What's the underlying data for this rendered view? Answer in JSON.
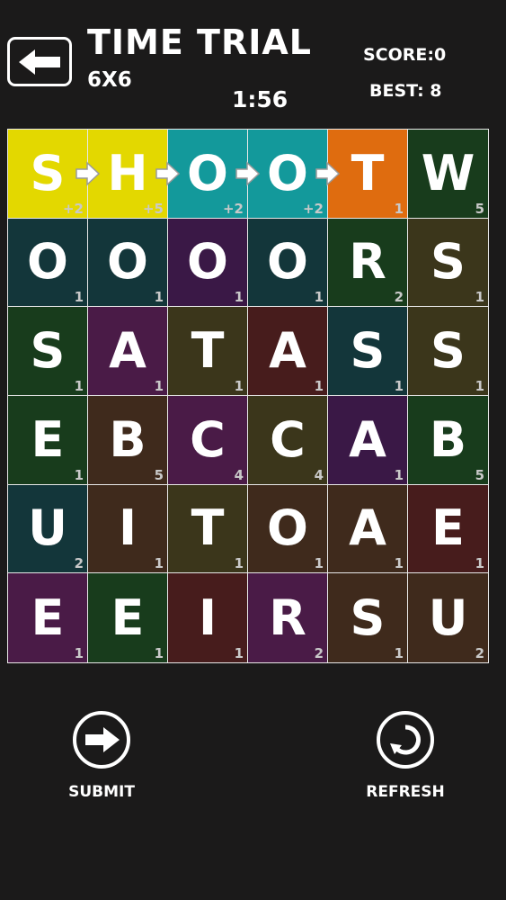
{
  "header": {
    "title": "TIME TRIAL",
    "mode": "6X6",
    "timer": "1:56",
    "score": "SCORE:0",
    "best": "BEST: 8"
  },
  "board": {
    "rows": [
      [
        {
          "letter": "S",
          "points": "+2",
          "color": "#e3d800",
          "arrow": true
        },
        {
          "letter": "H",
          "points": "+5",
          "color": "#e3d800",
          "arrow": true
        },
        {
          "letter": "O",
          "points": "+2",
          "color": "#13999b",
          "arrow": true
        },
        {
          "letter": "O",
          "points": "+2",
          "color": "#13999b",
          "arrow": true
        },
        {
          "letter": "T",
          "points": "1",
          "color": "#df6c0f",
          "arrow": false
        },
        {
          "letter": "W",
          "points": "5",
          "color": "#183c1c",
          "arrow": false
        }
      ],
      [
        {
          "letter": "O",
          "points": "1",
          "color": "#13363a",
          "arrow": false
        },
        {
          "letter": "O",
          "points": "1",
          "color": "#13363a",
          "arrow": false
        },
        {
          "letter": "O",
          "points": "1",
          "color": "#3a1846",
          "arrow": false
        },
        {
          "letter": "O",
          "points": "1",
          "color": "#13363a",
          "arrow": false
        },
        {
          "letter": "R",
          "points": "2",
          "color": "#183c1c",
          "arrow": false
        },
        {
          "letter": "S",
          "points": "1",
          "color": "#3b361b",
          "arrow": false
        }
      ],
      [
        {
          "letter": "S",
          "points": "1",
          "color": "#183c1c",
          "arrow": false
        },
        {
          "letter": "A",
          "points": "1",
          "color": "#4a1b47",
          "arrow": false
        },
        {
          "letter": "T",
          "points": "1",
          "color": "#3b361b",
          "arrow": false
        },
        {
          "letter": "A",
          "points": "1",
          "color": "#471c1c",
          "arrow": false
        },
        {
          "letter": "S",
          "points": "1",
          "color": "#13363a",
          "arrow": false
        },
        {
          "letter": "S",
          "points": "1",
          "color": "#3b361b",
          "arrow": false
        }
      ],
      [
        {
          "letter": "E",
          "points": "1",
          "color": "#183c1c",
          "arrow": false
        },
        {
          "letter": "B",
          "points": "5",
          "color": "#3f2a1c",
          "arrow": false
        },
        {
          "letter": "C",
          "points": "4",
          "color": "#4a1b47",
          "arrow": false
        },
        {
          "letter": "C",
          "points": "4",
          "color": "#3b361b",
          "arrow": false
        },
        {
          "letter": "A",
          "points": "1",
          "color": "#3a1846",
          "arrow": false
        },
        {
          "letter": "B",
          "points": "5",
          "color": "#183c1c",
          "arrow": false
        }
      ],
      [
        {
          "letter": "U",
          "points": "2",
          "color": "#13363a",
          "arrow": false
        },
        {
          "letter": "I",
          "points": "1",
          "color": "#3f2a1c",
          "arrow": false
        },
        {
          "letter": "T",
          "points": "1",
          "color": "#3b361b",
          "arrow": false
        },
        {
          "letter": "O",
          "points": "1",
          "color": "#3f2a1c",
          "arrow": false
        },
        {
          "letter": "A",
          "points": "1",
          "color": "#3f2a1c",
          "arrow": false
        },
        {
          "letter": "E",
          "points": "1",
          "color": "#471c1c",
          "arrow": false
        }
      ],
      [
        {
          "letter": "E",
          "points": "1",
          "color": "#4a1b47",
          "arrow": false
        },
        {
          "letter": "E",
          "points": "1",
          "color": "#183c1c",
          "arrow": false
        },
        {
          "letter": "I",
          "points": "1",
          "color": "#471c1c",
          "arrow": false
        },
        {
          "letter": "R",
          "points": "2",
          "color": "#4a1b47",
          "arrow": false
        },
        {
          "letter": "S",
          "points": "1",
          "color": "#3f2a1c",
          "arrow": false
        },
        {
          "letter": "U",
          "points": "2",
          "color": "#3f2a1c",
          "arrow": false
        }
      ]
    ]
  },
  "controls": {
    "submit_label": "SUBMIT",
    "refresh_label": "REFRESH",
    "submit_icon": "arrow-right-icon",
    "refresh_icon": "undo-arrow-icon",
    "back_icon": "arrow-left-icon"
  }
}
